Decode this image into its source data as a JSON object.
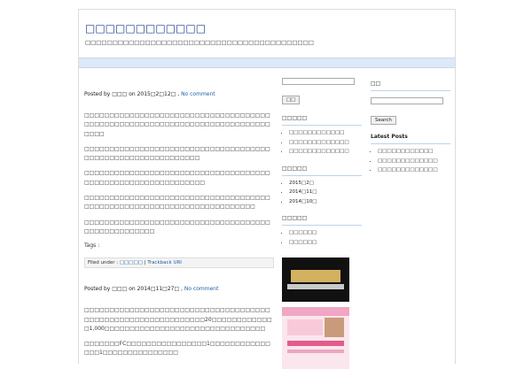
{
  "site": {
    "title": "□□□□□□□□□□□□",
    "description": "□□□□□□□□□□□□□□□□□□□□□□□□□□□□□□□□□□□□□□□□□□"
  },
  "posts": [
    {
      "by_prefix": "Posted by",
      "author": "□□□",
      "on_text": "on",
      "date": "2015□2□12□",
      "comment_link": "No comment",
      "paragraphs": [
        "□□□□□□□□□□□□□□□□□□□□□□□□□□□□□□□□□□□□□□□□□□□□□□□□□□□□□□□□□□□□□□□□□□□□□□□□□□□□□□",
        "□□□□□□□□□□□□□□□□□□□□□□□□□□□□□□□□□□□□□□□□□□□□□□□□□□□□□□□□□□□□",
        "□□□□□□□□□□□□□□□□□□□□□□□□□□□□□□□□□□□□□□□□□□□□□□□□□□□□□□□□□□□□□",
        "□□□□□□□□□□□□□□□□□□□□□□□□□□□□□□□□□□□□□□□□□□□□□□□□□□□□□□□□□□□□□□□□□□□□□□□",
        "□□□□□□□□□□□□□□□□□□□□□□□□□□□□□□□□□□□□□□□□□□□□□□□□□□□"
      ],
      "tags_label": "Tags :",
      "filed_label": "Filed under :",
      "category": "□□□□□",
      "trackback": "Trackback URI"
    },
    {
      "by_prefix": "Posted by",
      "author": "□□□",
      "on_text": "on",
      "date": "2014□11□27□",
      "comment_link": "No comment",
      "paragraphs": [
        "□□□□□□□□□□□□□□□□□□□□□□□□□□□□□□□□□□□□□□□□□□□□□□□□□□□□□□□□□□□□□20□□□□□□□□□□□□□1,000□□□□□□□□□□□□□□□□□□□□□□□□□□□□□□□□",
        "□□□□□□□FC□□□□□□□□□□□□□□□□1□□□□□□□□□□□□□□□1□□□□□□□□□□□□□□□"
      ]
    }
  ],
  "sidebar": {
    "search_button": "□□",
    "recent_title": "□□□□□",
    "recent_items": [
      "□□□□□□□□□□□□",
      "□□□□□□□□□□□□□",
      "□□□□□□□□□□□□□"
    ],
    "archives_title": "□□□□□",
    "archives": [
      "2015□2□",
      "2014□11□",
      "2014□10□"
    ],
    "categories_title": "□□□□□",
    "categories": [
      "□□□□□□",
      "□□□□□□"
    ]
  },
  "sidebar2": {
    "search_title": "□□",
    "search_button": "Search",
    "latest_title": "Latest Posts",
    "latest_items": [
      "□□□□□□□□□□□□",
      "□□□□□□□□□□□□□",
      "□□□□□□□□□□□□□"
    ]
  },
  "colors": {
    "link": "#1f5fa8",
    "title": "#1a3e8c",
    "navbar": "#dce9f7"
  }
}
